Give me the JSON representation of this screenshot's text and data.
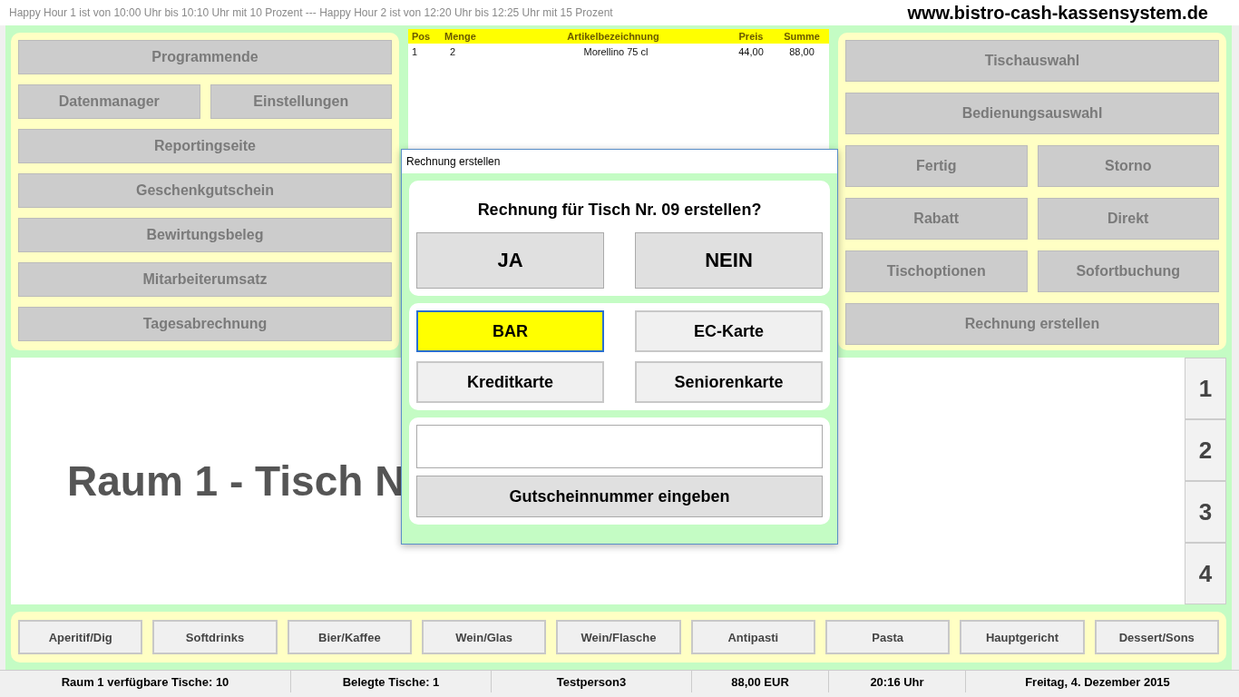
{
  "title_bar": {
    "happy_hour": "Happy Hour 1 ist von 10:00 Uhr bis 10:10 Uhr mit 10 Prozent --- Happy Hour 2 ist von 12:20 Uhr bis 12:25 Uhr mit 15 Prozent",
    "website": "www.bistro-cash-kassensystem.de"
  },
  "left_menu": [
    [
      "Programmende"
    ],
    [
      "Datenmanager",
      "Einstellungen"
    ],
    [
      "Reportingseite"
    ],
    [
      "Geschenkgutschein"
    ],
    [
      "Bewirtungsbeleg"
    ],
    [
      "Mitarbeiterumsatz"
    ],
    [
      "Tagesabrechnung"
    ]
  ],
  "order_table": {
    "columns": [
      "Pos",
      "Menge",
      "Artikelbezeichnung",
      "Preis",
      "Summe"
    ],
    "rows": [
      [
        "1",
        "2",
        "Morellino 75 cl",
        "44,00",
        "88,00"
      ]
    ]
  },
  "right_menu": [
    [
      "Tischauswahl"
    ],
    [
      "Bedienungsauswahl"
    ],
    [
      "Fertig",
      "Storno"
    ],
    [
      "Rabatt",
      "Direkt"
    ],
    [
      "Tischoptionen",
      "Sofortbuchung"
    ],
    [
      "Rechnung erstellen"
    ]
  ],
  "table_heading": "Raum 1 - Tisch N",
  "room_numbers": [
    "1",
    "2",
    "3",
    "4"
  ],
  "categories": [
    "Aperitif/Dig",
    "Softdrinks",
    "Bier/Kaffee",
    "Wein/Glas",
    "Wein/Flasche",
    "Antipasti",
    "Pasta",
    "Hauptgericht",
    "Dessert/Sons"
  ],
  "status_bar": [
    "Raum 1 verfügbare Tische: 10",
    "Belegte Tische: 1",
    "Testperson3",
    "88,00 EUR",
    "20:16 Uhr",
    "Freitag, 4. Dezember 2015"
  ],
  "dialog": {
    "title": "Rechnung erstellen",
    "question": "Rechnung für Tisch Nr. 09 erstellen?",
    "confirm_buttons": [
      "JA",
      "NEIN"
    ],
    "payment_methods": [
      {
        "label": "BAR",
        "selected": true
      },
      {
        "label": "EC-Karte",
        "selected": false
      },
      {
        "label": "Kreditkarte",
        "selected": false
      },
      {
        "label": "Seniorenkarte",
        "selected": false
      }
    ],
    "voucher_button": "Gutscheinnummer eingeben"
  }
}
